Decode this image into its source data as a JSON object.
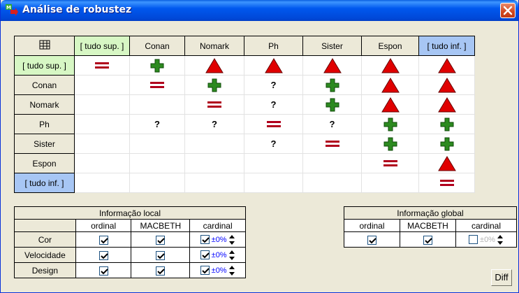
{
  "window": {
    "title": "Análise de robustez"
  },
  "grid": {
    "corner_icon": "table-grid-icon",
    "columns": [
      "[ tudo sup. ]",
      "Conan",
      "Nomark",
      "Ph",
      "Sister",
      "Espon",
      "[ tudo inf. ]"
    ],
    "rows": [
      "[ tudo sup. ]",
      "Conan",
      "Nomark",
      "Ph",
      "Sister",
      "Espon",
      "[ tudo inf. ]"
    ],
    "cells": [
      [
        "eq",
        "plus",
        "tri",
        "tri",
        "tri",
        "tri",
        "tri"
      ],
      [
        "",
        "eq",
        "plus",
        "?",
        "plus",
        "tri",
        "tri"
      ],
      [
        "",
        "",
        "eq",
        "?",
        "plus",
        "tri",
        "tri"
      ],
      [
        "",
        "?",
        "?",
        "eq",
        "?",
        "plus",
        "plus"
      ],
      [
        "",
        "",
        "",
        "?",
        "eq",
        "plus",
        "plus"
      ],
      [
        "",
        "",
        "",
        "",
        "",
        "eq",
        "tri"
      ],
      [
        "",
        "",
        "",
        "",
        "",
        "",
        "eq"
      ]
    ],
    "colors": {
      "green_header": "#d7f7c4",
      "blue_header": "#a7c6f4",
      "equal": "#b0001c",
      "plus": "#2c8a1f",
      "triangle": "#e00000"
    }
  },
  "local": {
    "title": "Informação local",
    "headers": [
      "ordinal",
      "MACBETH",
      "cardinal"
    ],
    "rows": [
      {
        "label": "Cor",
        "ordinal": true,
        "macbeth": true,
        "cardinal": true,
        "pct": "±0%"
      },
      {
        "label": "Velocidade",
        "ordinal": true,
        "macbeth": true,
        "cardinal": true,
        "pct": "±0%"
      },
      {
        "label": "Design",
        "ordinal": true,
        "macbeth": true,
        "cardinal": true,
        "pct": "±0%"
      }
    ]
  },
  "global": {
    "title": "Informação global",
    "headers": [
      "ordinal",
      "MACBETH",
      "cardinal"
    ],
    "row": {
      "ordinal": true,
      "macbeth": true,
      "cardinal": false,
      "pct": "±0%"
    }
  },
  "buttons": {
    "diff": "Diff"
  }
}
